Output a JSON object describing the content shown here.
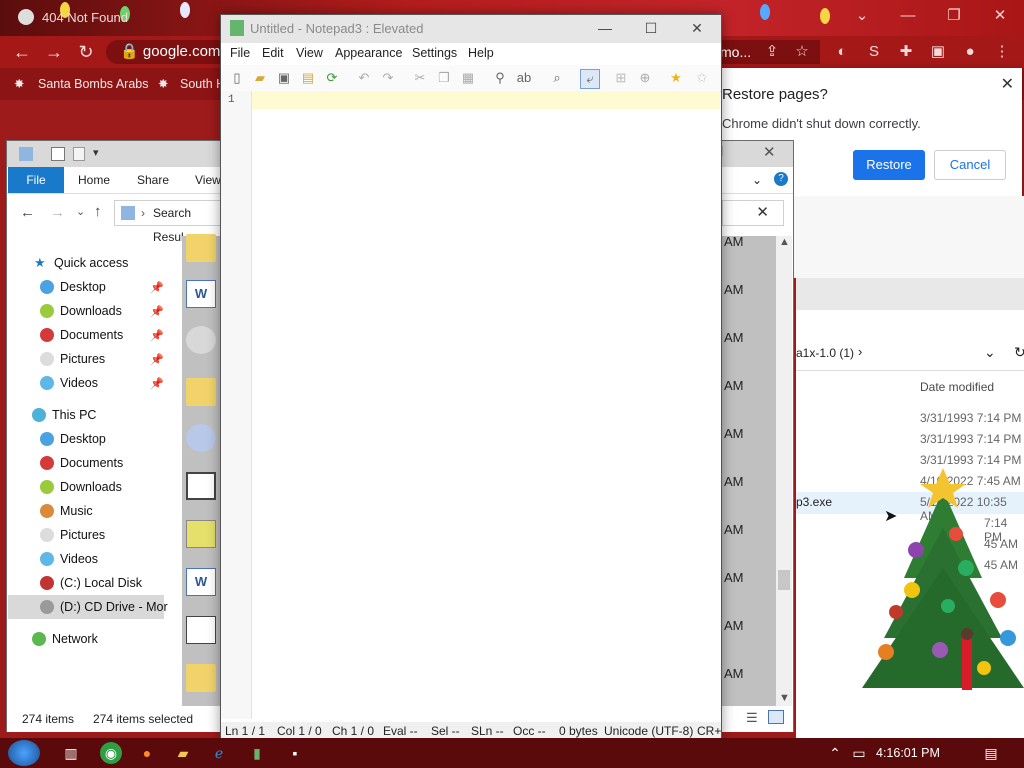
{
  "chrome": {
    "tab_title": "404 Not Found",
    "url": "google.com/",
    "omni_tail": "mo...",
    "bookmarks": [
      "Santa Bombs Arabs",
      "South H"
    ],
    "restore": {
      "title": "Restore pages?",
      "message": "Chrome didn't shut down correctly.",
      "restore_label": "Restore",
      "cancel_label": "Cancel"
    }
  },
  "explorer": {
    "ribbon_tabs": [
      "File",
      "Home",
      "Share",
      "View"
    ],
    "address": "Search Resul",
    "quick_access": [
      "Quick access",
      "Desktop",
      "Downloads",
      "Documents",
      "Pictures",
      "Videos"
    ],
    "this_pc": [
      "This PC",
      "Desktop",
      "Documents",
      "Downloads",
      "Music",
      "Pictures",
      "Videos",
      "(C:) Local Disk",
      "(D:) CD Drive - Mor"
    ],
    "network": "Network",
    "am_label": "AM",
    "status_items": "274 items",
    "status_selected": "274 items selected"
  },
  "explorer2": {
    "path": "a1x-1.0 (1)",
    "col_date": "Date modified",
    "file": "p3.exe",
    "dates": [
      "3/31/1993 7:14 PM",
      "3/31/1993 7:14 PM",
      "3/31/1993 7:14 PM",
      "4/10/2022 7:45 AM",
      "5/18/2022 10:35 AM",
      "7:14 PM",
      "45 AM",
      "45 AM"
    ]
  },
  "notepad": {
    "title": "Untitled - Notepad3 : Elevated",
    "menu": [
      "File",
      "Edit",
      "View",
      "Appearance",
      "Settings",
      "Help"
    ],
    "line_number": "1",
    "status": [
      "Ln  1 / 1",
      "Col  1 / 0",
      "Ch  1 / 0",
      "Eval  --",
      "Sel  --",
      "SLn  --",
      "Occ  --",
      "0 bytes",
      "Unicode (UTF-8)",
      "CR+"
    ]
  },
  "taskbar": {
    "clock": "4:16:01 PM"
  },
  "colors": {
    "chrome_red": "#a51818",
    "accent_blue": "#1a73e8",
    "file_tab": "#1979ca",
    "current_line": "#fefbd2"
  }
}
